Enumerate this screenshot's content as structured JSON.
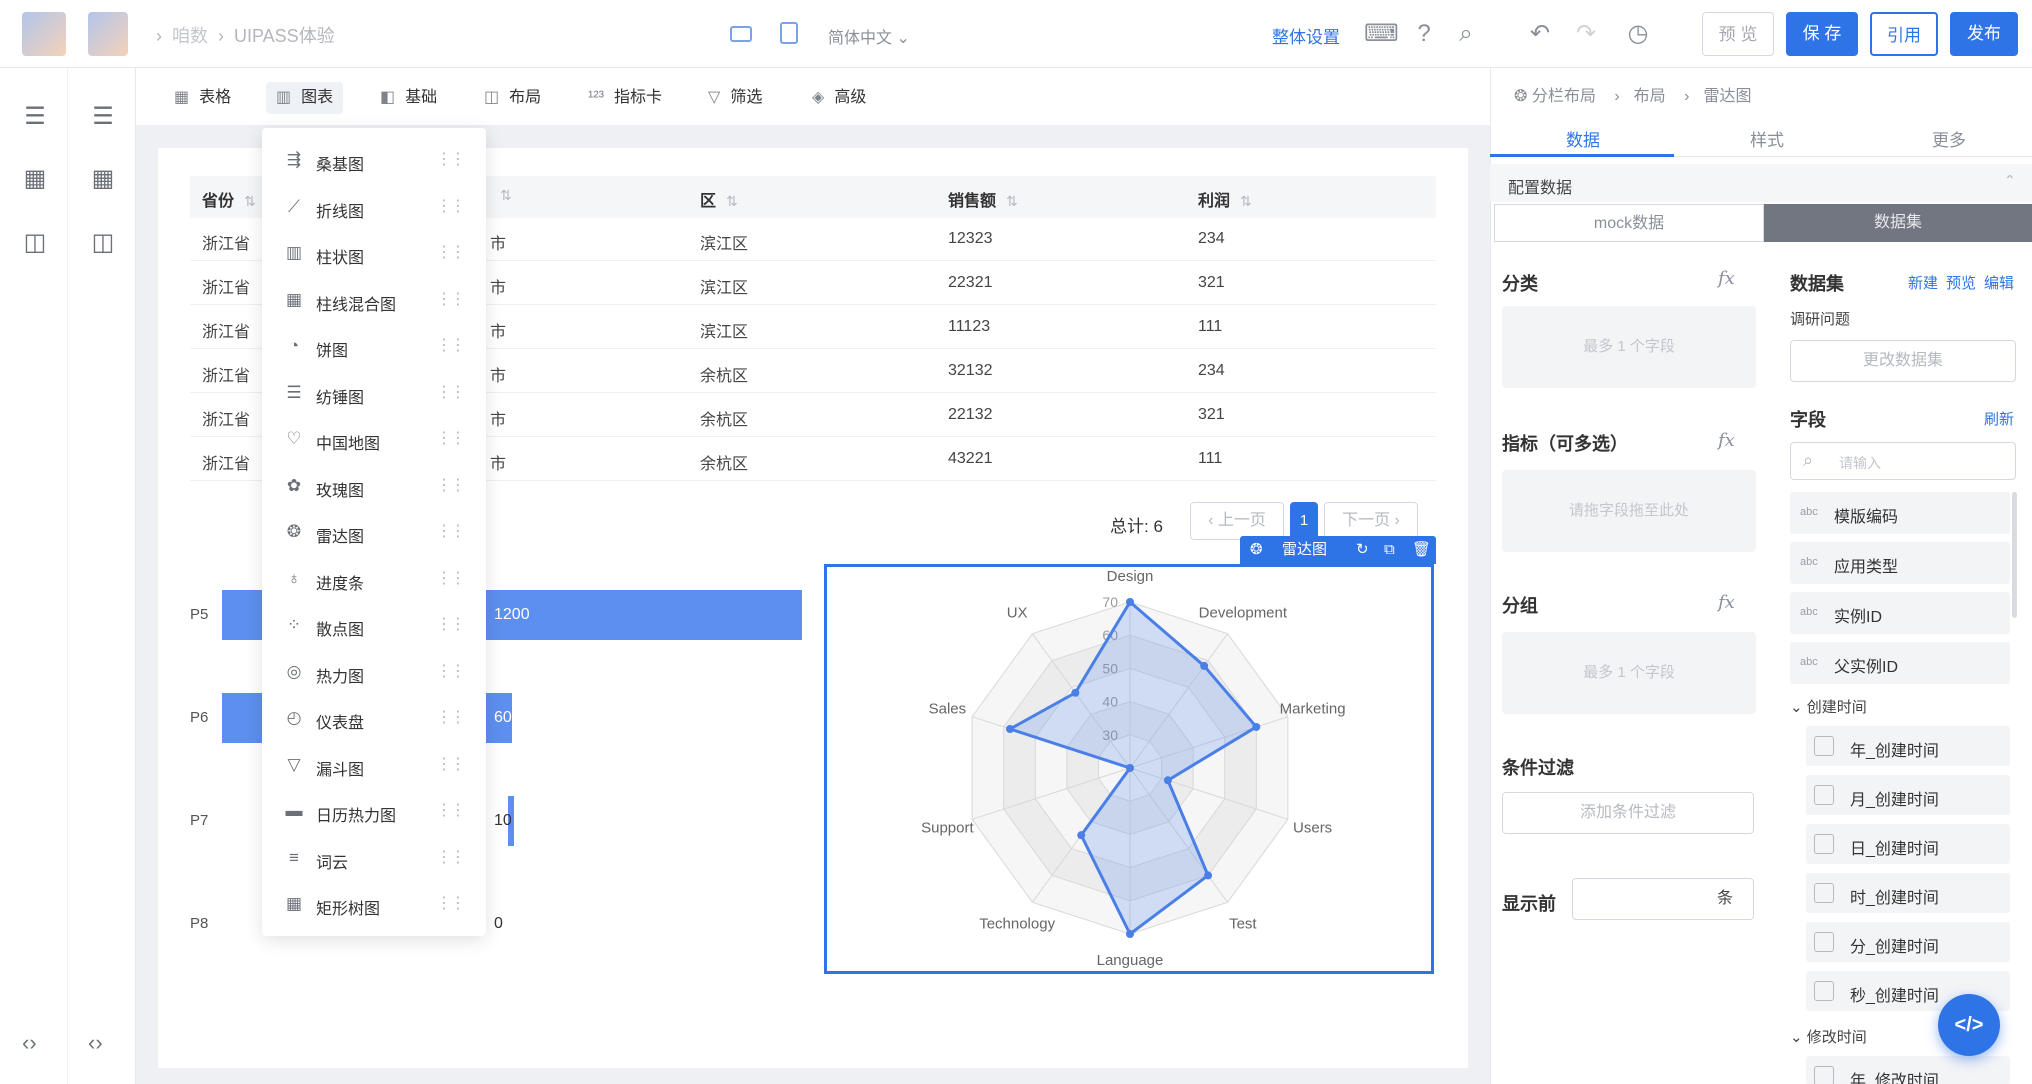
{
  "header": {
    "breadcrumb": [
      "咱数",
      "UIPASS体验"
    ],
    "lang": "简体中文",
    "global_settings": "整体设置",
    "buttons": {
      "preview": "预 览",
      "save": "保 存",
      "quote": "引用",
      "publish": "发布"
    }
  },
  "toolbar": {
    "items": [
      {
        "icon": "table-icon",
        "label": "表格"
      },
      {
        "icon": "chart-icon",
        "label": "图表"
      },
      {
        "icon": "basic-icon",
        "label": "基础"
      },
      {
        "icon": "layout-icon",
        "label": "布局"
      },
      {
        "icon": "kpi-card-icon",
        "label": "指标卡"
      },
      {
        "icon": "filter-icon",
        "label": "筛选"
      },
      {
        "icon": "advanced-icon",
        "label": "高级"
      }
    ]
  },
  "chart_menu": [
    "桑基图",
    "折线图",
    "柱状图",
    "柱线混合图",
    "饼图",
    "纺锤图",
    "中国地图",
    "玫瑰图",
    "雷达图",
    "进度条",
    "散点图",
    "热力图",
    "仪表盘",
    "漏斗图",
    "日历热力图",
    "词云",
    "矩形树图"
  ],
  "table": {
    "headers": [
      "省份",
      "市",
      "区",
      "销售额",
      "利润"
    ],
    "rows": [
      [
        "浙江省",
        "市",
        "滨江区",
        "12323",
        "234"
      ],
      [
        "浙江省",
        "市",
        "滨江区",
        "22321",
        "321"
      ],
      [
        "浙江省",
        "市",
        "滨江区",
        "11123",
        "111"
      ],
      [
        "浙江省",
        "市",
        "余杭区",
        "32132",
        "234"
      ],
      [
        "浙江省",
        "市",
        "余杭区",
        "22132",
        "321"
      ],
      [
        "浙江省",
        "市",
        "余杭区",
        "43221",
        "111"
      ]
    ]
  },
  "pager": {
    "total": "总计: 6",
    "prev": "上一页",
    "next": "下一页",
    "current": "1"
  },
  "bars": [
    {
      "label": "P5",
      "value": "1200",
      "fraction": 1.0
    },
    {
      "label": "P6",
      "value": "600",
      "fraction": 0.5
    },
    {
      "label": "P7",
      "value": "10",
      "fraction": 0.0083
    },
    {
      "label": "P8",
      "value": "0",
      "fraction": 0
    }
  ],
  "radar": {
    "toolbar_label": "雷达图",
    "chart_data": {
      "type": "radar",
      "axes": [
        "Design",
        "Development",
        "Marketing",
        "Users",
        "Test",
        "Language",
        "Technology",
        "Support",
        "Sales",
        "UX"
      ],
      "max": 70,
      "ticks": [
        "70",
        "60",
        "50",
        "40",
        "30"
      ],
      "series": [
        {
          "values": [
            70,
            58,
            60,
            32,
            60,
            70,
            45,
            20,
            58,
            48
          ]
        }
      ]
    }
  },
  "right_panel": {
    "breadcrumb": [
      "分栏布局",
      "布局",
      "雷达图"
    ],
    "tabs": [
      "数据",
      "样式",
      "更多"
    ],
    "config_title": "配置数据",
    "source_toggle": [
      "mock数据",
      "数据集"
    ],
    "category": {
      "title": "分类",
      "placeholder": "最多 1 个字段"
    },
    "metric": {
      "title": "指标（可多选）",
      "placeholder": "请拖字段拖至此处"
    },
    "group": {
      "title": "分组",
      "placeholder": "最多 1 个字段"
    },
    "filter": {
      "title": "条件过滤",
      "button": "添加条件过滤"
    },
    "show_top": {
      "title": "显示前",
      "unit": "条"
    },
    "dataset": {
      "title": "数据集",
      "new": "新建",
      "preview": "预览",
      "edit": "编辑",
      "name": "调研问题",
      "change": "更改数据集"
    },
    "fields": {
      "title": "字段",
      "refresh": "刷新",
      "search_placeholder": "请输入",
      "items": [
        {
          "type": "abc",
          "label": "模版编码"
        },
        {
          "type": "abc",
          "label": "应用类型"
        },
        {
          "type": "abc",
          "label": "实例ID"
        },
        {
          "type": "abc",
          "label": "父实例ID"
        }
      ],
      "group_created": "创建时间",
      "created_items": [
        "年_创建时间",
        "月_创建时间",
        "日_创建时间",
        "时_创建时间",
        "分_创建时间",
        "秒_创建时间"
      ],
      "group_modified": "修改时间",
      "modified_items": [
        "年_修改时间"
      ]
    }
  }
}
